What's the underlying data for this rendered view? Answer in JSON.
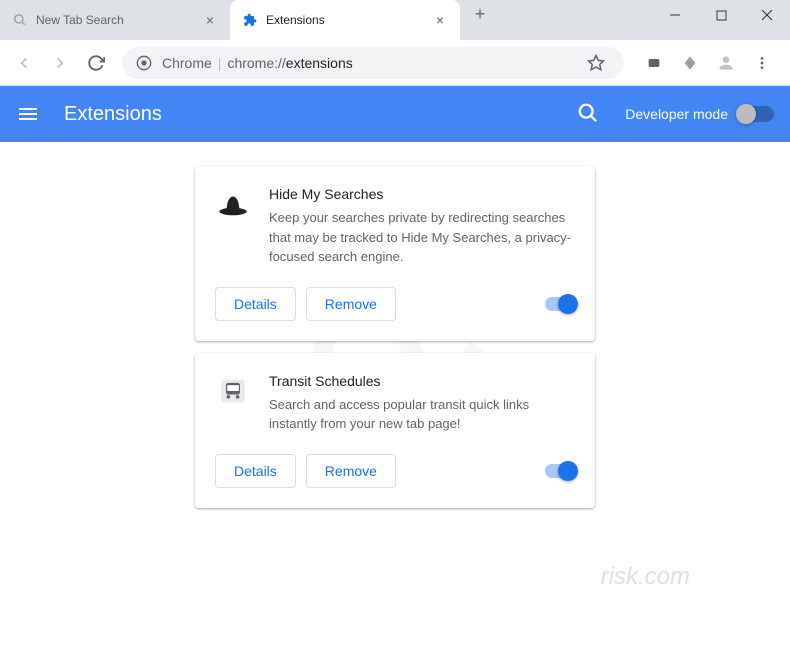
{
  "tabs": [
    {
      "title": "New Tab Search",
      "active": false
    },
    {
      "title": "Extensions",
      "active": true
    }
  ],
  "address": {
    "scheme": "Chrome",
    "path_prefix": "chrome://",
    "path_bold": "extensions"
  },
  "header": {
    "title": "Extensions",
    "dev_mode_label": "Developer mode"
  },
  "extensions": [
    {
      "name": "Hide My Searches",
      "description": "Keep your searches private by redirecting searches that may be tracked to Hide My Searches, a privacy-focused search engine.",
      "enabled": true,
      "icon": "hat"
    },
    {
      "name": "Transit Schedules",
      "description": "Search and access popular transit quick links instantly from your new tab page!",
      "enabled": true,
      "icon": "bus"
    }
  ],
  "buttons": {
    "details": "Details",
    "remove": "Remove"
  }
}
